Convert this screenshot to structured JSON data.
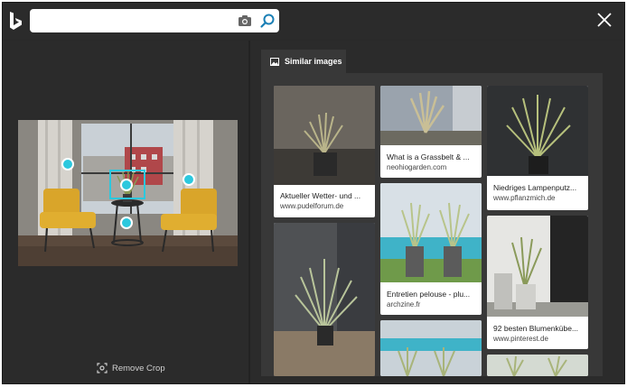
{
  "search": {
    "value": "",
    "placeholder": ""
  },
  "icons": {
    "logo": "bing-logo-icon",
    "camera": "camera-icon",
    "search": "search-icon",
    "close": "close-icon",
    "crop": "crop-icon",
    "tab": "image-icon"
  },
  "colors": {
    "accent": "#2cc8de",
    "background": "#2b2b2b",
    "panel": "#383838"
  },
  "left": {
    "remove_crop_label": "Remove Crop"
  },
  "right": {
    "tab_label": "Similar images",
    "results": [
      {
        "caption": "Aktueller Wetter- und ...",
        "source": "www.pudelforum.de"
      },
      {
        "caption": "What is a Grassbelt & ...",
        "source": "neohiogarden.com"
      },
      {
        "caption": "Niedriges Lampenputz...",
        "source": "www.pflanzmich.de"
      },
      {
        "caption": "Entretien pelouse - plu...",
        "source": "archzine.fr"
      },
      {
        "caption": "92 besten Blumenkübe...",
        "source": "www.pinterest.de"
      }
    ]
  }
}
